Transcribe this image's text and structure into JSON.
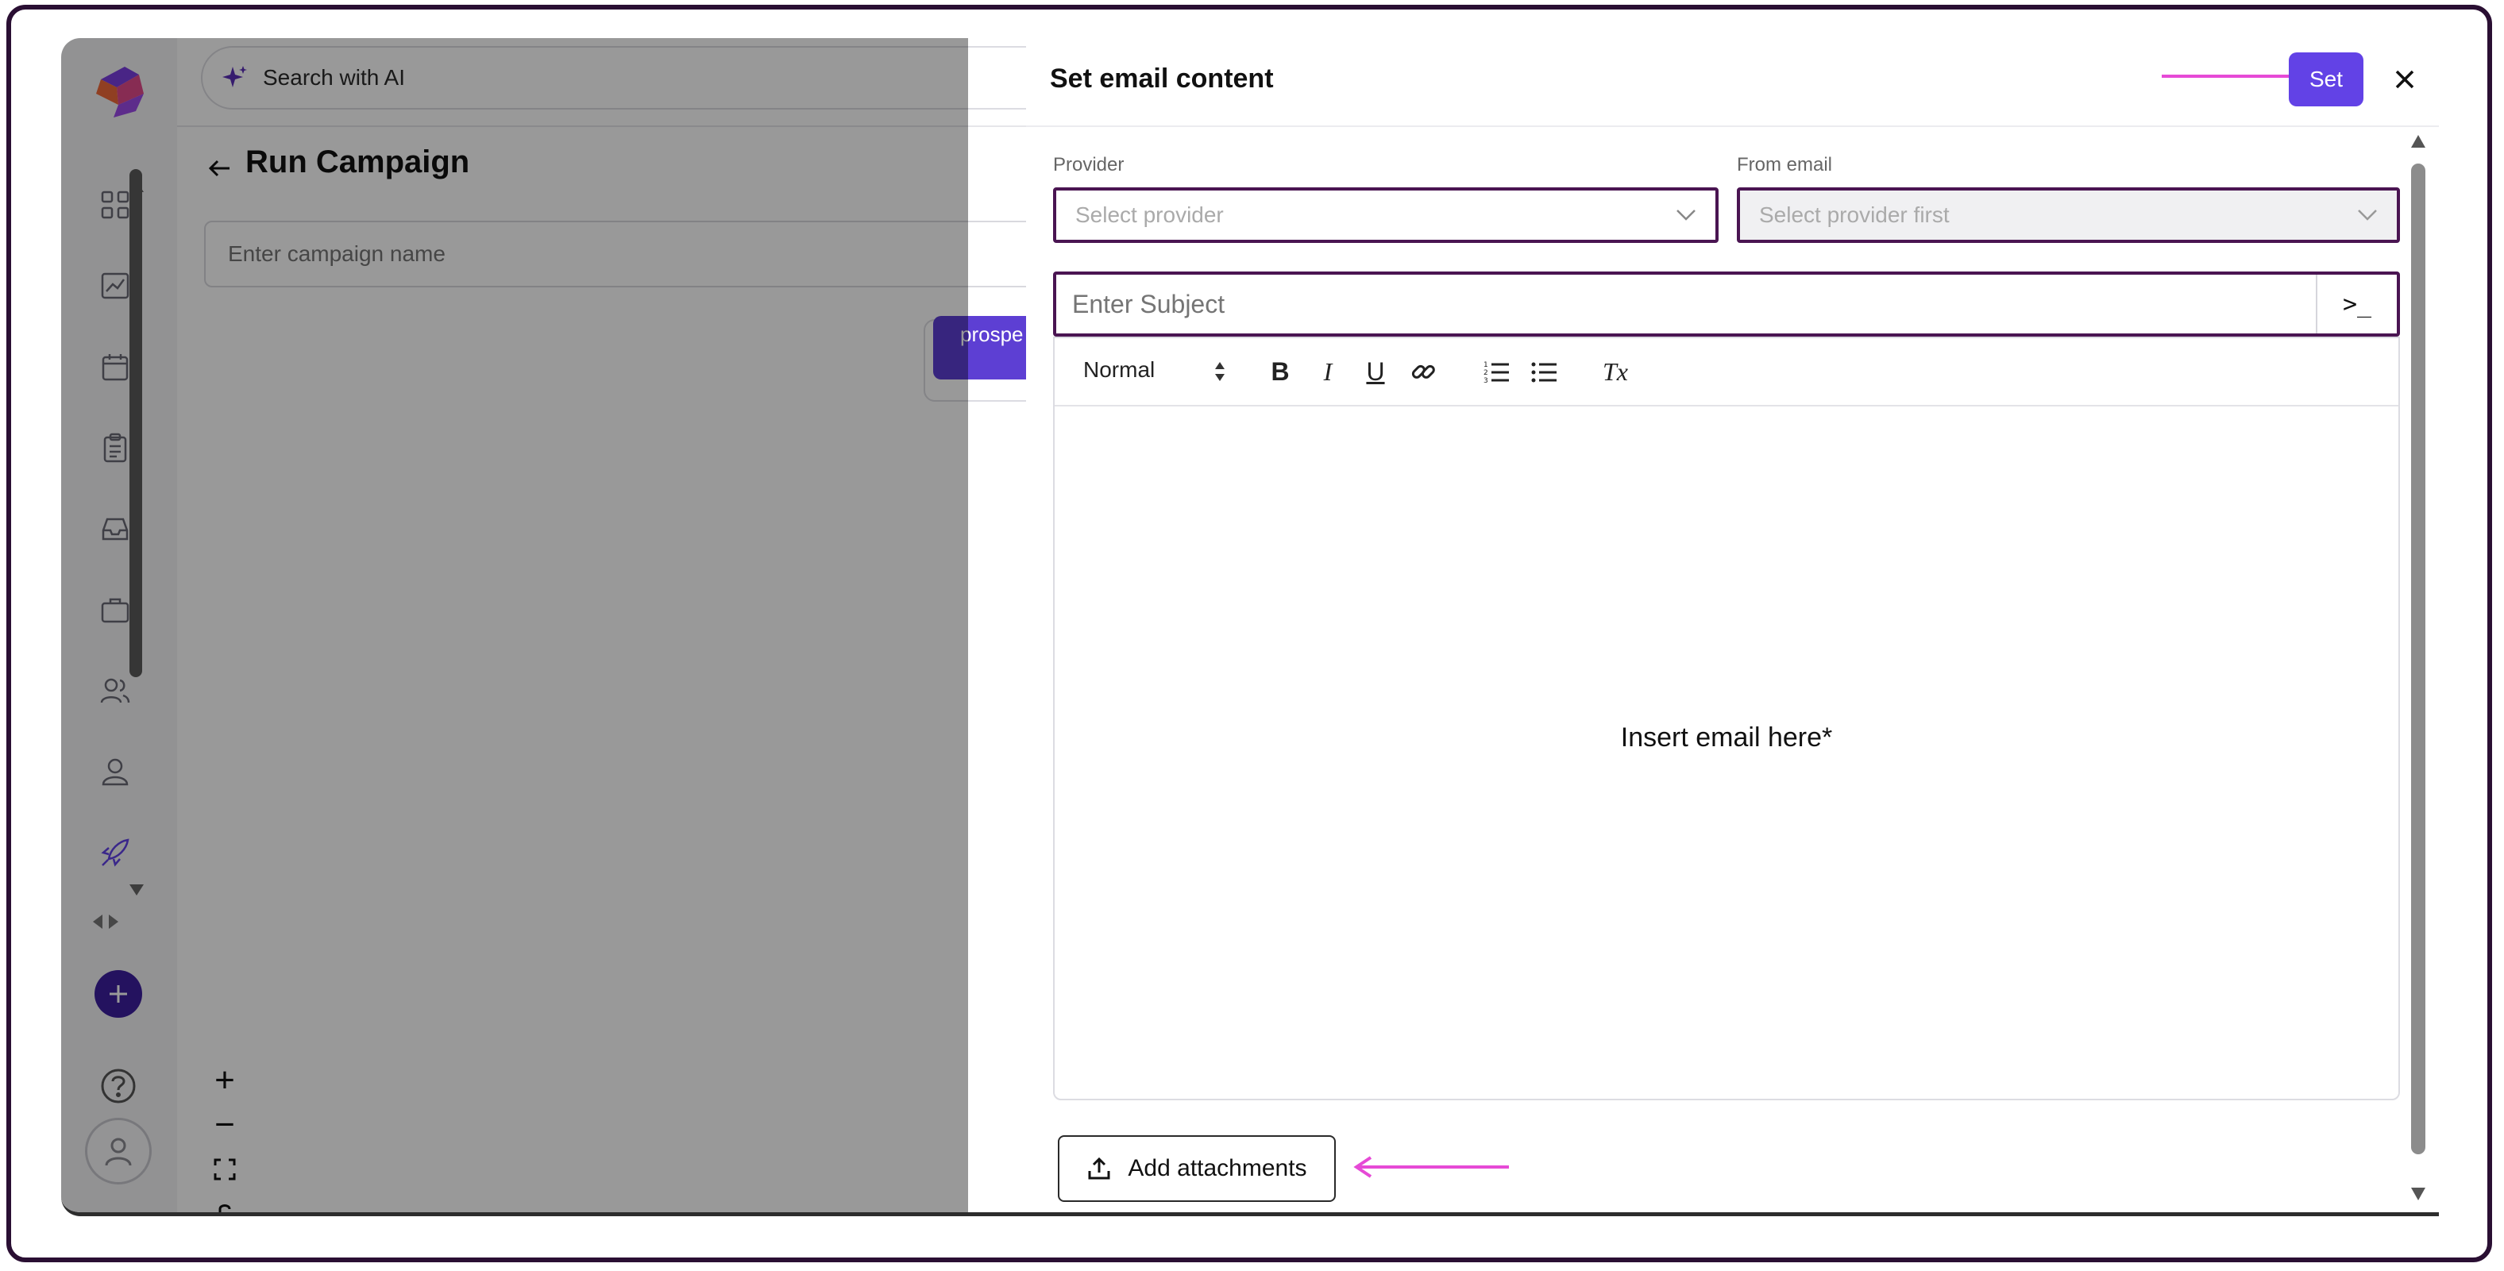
{
  "search": {
    "label": "Search with AI"
  },
  "header": {
    "title": "Run Campaign"
  },
  "campaign": {
    "placeholder": "Enter campaign name"
  },
  "canvas": {
    "node_label": "prospe"
  },
  "sidebar": {
    "icons": [
      "dashboard-icon",
      "analytics-icon",
      "calendar-icon",
      "clipboard-icon",
      "inbox-icon",
      "briefcase-icon",
      "users-icon",
      "user-icon",
      "rocket-icon"
    ]
  },
  "zoom": {
    "plus": "+",
    "minus": "−"
  },
  "modal": {
    "title": "Set email content",
    "set_label": "Set",
    "provider_label": "Provider",
    "provider_placeholder": "Select provider",
    "from_label": "From email",
    "from_placeholder": "Select provider first",
    "subject_placeholder": "Enter Subject",
    "subject_button": ">_",
    "toolbar": {
      "format": "Normal",
      "bold": "B",
      "italic": "I",
      "underline": "U",
      "clear": "Tx"
    },
    "editor_placeholder": "Insert email here*",
    "attach_label": "Add attachments"
  },
  "colors": {
    "accent": "#6242e6",
    "brand_dark": "#3d1f9e",
    "focus_border": "#4a1552",
    "annotation": "#e64ad6"
  }
}
